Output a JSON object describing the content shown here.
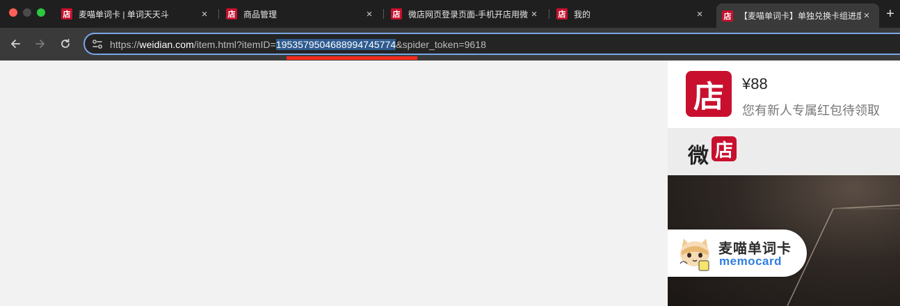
{
  "tabs": [
    {
      "favicon": "店",
      "title": "麦喵单词卡 | 单词天天斗",
      "active": false
    },
    {
      "favicon": "店",
      "title": "商品管理",
      "active": false
    },
    {
      "favicon": "店",
      "title": "微店网页登录页面-手机开店用微",
      "active": false
    },
    {
      "favicon": "店",
      "title": "我的",
      "active": false
    },
    {
      "favicon": "店",
      "title": "【麦喵单词卡】单独兑换卡组进度",
      "active": true
    }
  ],
  "tab_close_glyph": "×",
  "new_tab_glyph": "+",
  "url": {
    "scheme": "https://",
    "host": "weidian.com",
    "path": "/item.html?itemID=",
    "selected": "1953579504688994745774",
    "rest": "&spider_token=9618"
  },
  "icons": {
    "back": "back-arrow-icon",
    "forward": "forward-arrow-icon",
    "reload": "reload-icon",
    "site_info": "tune-icon"
  },
  "page": {
    "banner": {
      "logo_char": "店",
      "price": "¥88",
      "promo": "您有新人专属红包待领取"
    },
    "brand": {
      "wei": "微",
      "dian": "店"
    },
    "product_card": {
      "name": "麦喵单词卡",
      "subtitle": "memocard"
    }
  },
  "colors": {
    "brand_red": "#c8102e",
    "url_selection": "#2e5b8f",
    "annotation_red": "#ff2a1a",
    "memocard_blue": "#2f7ee0"
  }
}
